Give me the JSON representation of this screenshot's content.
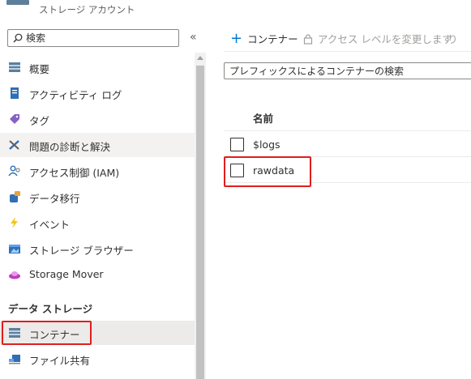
{
  "header": {
    "subtitle": "ストレージ アカウント"
  },
  "sidebar": {
    "search_placeholder": "検索",
    "collapse_glyph": "«",
    "items": [
      {
        "label": "概要",
        "icon": "overview-icon"
      },
      {
        "label": "アクティビティ ログ",
        "icon": "activity-log-icon"
      },
      {
        "label": "タグ",
        "icon": "tag-icon"
      },
      {
        "label": "問題の診断と解決",
        "icon": "wrench-icon"
      },
      {
        "label": "アクセス制御 (IAM)",
        "icon": "iam-icon"
      },
      {
        "label": "データ移行",
        "icon": "data-migration-icon"
      },
      {
        "label": "イベント",
        "icon": "lightning-icon"
      },
      {
        "label": "ストレージ ブラウザー",
        "icon": "storage-browser-icon"
      },
      {
        "label": "Storage Mover",
        "icon": "storage-mover-icon"
      }
    ],
    "section_title": "データ ストレージ",
    "section_items": [
      {
        "label": "コンテナー",
        "icon": "container-icon"
      },
      {
        "label": "ファイル共有",
        "icon": "file-share-icon"
      }
    ]
  },
  "toolbar": {
    "add_label": "コンテナー",
    "access_label": "アクセス レベルを変更します",
    "undo_glyph": "り"
  },
  "filter": {
    "placeholder": "プレフィックスによるコンテナーの検索"
  },
  "table": {
    "header": "名前",
    "rows": [
      {
        "name": "$logs"
      },
      {
        "name": "rawdata"
      }
    ]
  },
  "colors": {
    "highlight": "#e01e1e",
    "accent": "#0078d4"
  }
}
